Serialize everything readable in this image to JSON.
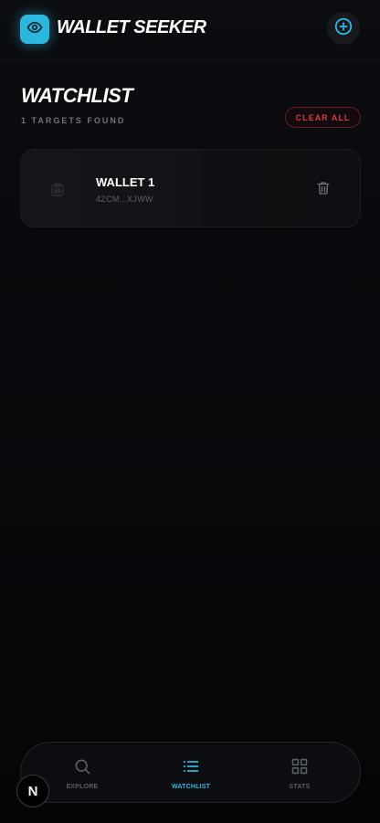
{
  "header": {
    "app_title": "WALLET SEEKER",
    "logo_icon": "eye-icon",
    "add_icon": "plus-circle-icon"
  },
  "watchlist": {
    "title": "WATCHLIST",
    "count_text": "1 TARGETS FOUND",
    "clear_label": "CLEAR ALL",
    "items": [
      {
        "name": "WALLET 1",
        "address": "4ZCM...XJWW",
        "icon": "wallet-icon",
        "action_icon": "trash-icon"
      }
    ]
  },
  "nav": {
    "items": [
      {
        "label": "EXPLORE",
        "icon": "search-icon",
        "active": false
      },
      {
        "label": "WATCHLIST",
        "icon": "list-icon",
        "active": true
      },
      {
        "label": "STATS",
        "icon": "grid-icon",
        "active": false
      }
    ]
  },
  "badge": {
    "letter": "N"
  },
  "colors": {
    "accent": "#2bb8de",
    "danger": "#d33a48",
    "background": "#060608"
  }
}
